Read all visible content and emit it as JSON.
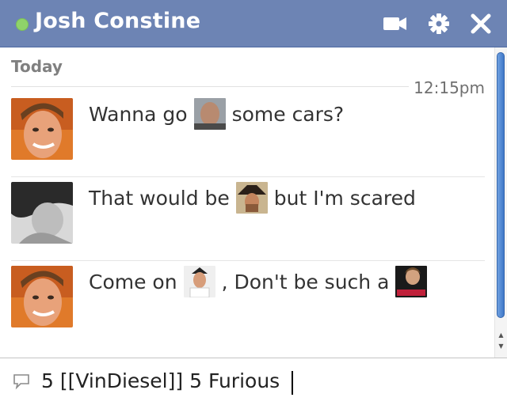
{
  "chat_window": {
    "contact_name": "Josh Constine",
    "presence": "online",
    "presence_color": "#8fd36a",
    "header_color": "#6d84b4",
    "icons": [
      "video-call-icon",
      "gear-icon",
      "close-icon"
    ]
  },
  "conversation": {
    "day_label": "Today",
    "timestamp": "12:15pm",
    "messages": [
      {
        "before": "Wanna go",
        "emoticon": "vin-diesel-photo",
        "after": "some cars?"
      },
      {
        "before": "That would be",
        "emoticon": "chuck-norris-photo",
        "after": "but I'm scared"
      },
      {
        "before": "Come on",
        "emoticon": "pauly-d-photo",
        "after": ", Don't be such a",
        "emoticon2": "justin-bieber-photo"
      }
    ]
  },
  "composer": {
    "value": "5 [[VinDiesel]] 5 Furious",
    "icon": "speech-bubble-icon"
  }
}
